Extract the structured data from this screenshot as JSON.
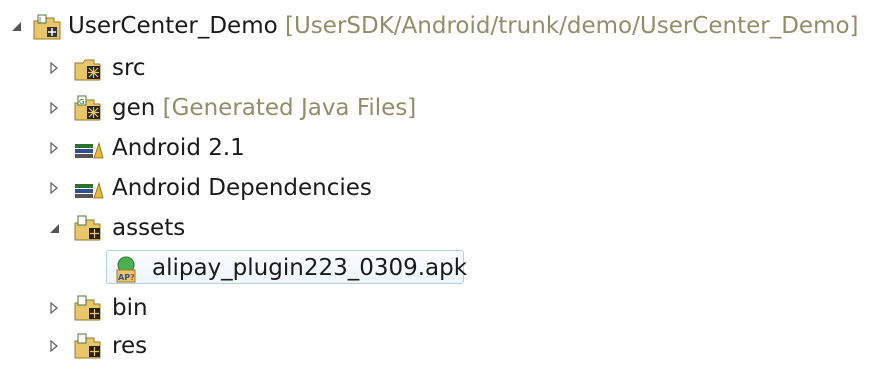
{
  "project": {
    "name": "UserCenter_Demo",
    "decoration": "[UserSDK/Android/trunk/demo/UserCenter_Demo]",
    "expanded": true,
    "icon": "project-folder-icon"
  },
  "items": [
    {
      "label": "src",
      "decoration": "",
      "expanded": false,
      "icon": "source-folder-icon"
    },
    {
      "label": "gen",
      "decoration": "[Generated Java Files]",
      "expanded": false,
      "icon": "generated-folder-icon"
    },
    {
      "label": "Android 2.1",
      "decoration": "",
      "expanded": false,
      "icon": "library-icon"
    },
    {
      "label": "Android Dependencies",
      "decoration": "",
      "expanded": false,
      "icon": "library-icon"
    },
    {
      "label": "assets",
      "decoration": "",
      "expanded": true,
      "icon": "folder-icon"
    },
    {
      "label": "alipay_plugin223_0309.apk",
      "decoration": "",
      "selected": true,
      "icon": "apk-file-icon"
    },
    {
      "label": "bin",
      "decoration": "",
      "expanded": false,
      "icon": "folder-icon"
    },
    {
      "label": "res",
      "decoration": "",
      "expanded": false,
      "icon": "folder-icon"
    }
  ],
  "colors": {
    "decoration": "#8f8f6a",
    "selection_border": "#b6cfe6",
    "selection_fill": "#eef5fc"
  }
}
